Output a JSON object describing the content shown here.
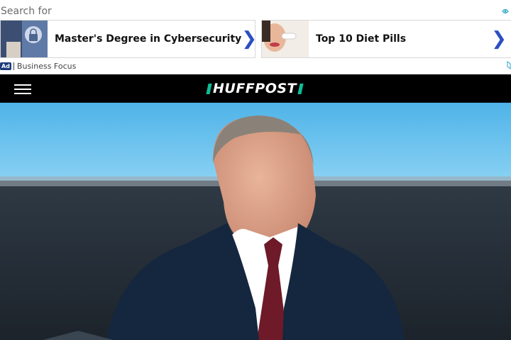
{
  "ad": {
    "search_label": "Search for",
    "cards": [
      {
        "title": "Master's Degree in Cybersecurity",
        "chevron": "❯",
        "thumb_icon": "cybersecurity-lock-thumbnail"
      },
      {
        "title": "Top 10 Diet Pills",
        "chevron": "❯",
        "thumb_icon": "woman-holding-pill-thumbnail"
      }
    ],
    "badge": "Ad",
    "source": "Business Focus",
    "accent_color": "#2a4ec4"
  },
  "nav": {
    "logo": "HUFFPOST",
    "logo_accent": "#0dbe98",
    "menu_icon": "hamburger-menu-icon"
  },
  "hero": {
    "image_subject": "man-in-dark-suit-portrait"
  }
}
